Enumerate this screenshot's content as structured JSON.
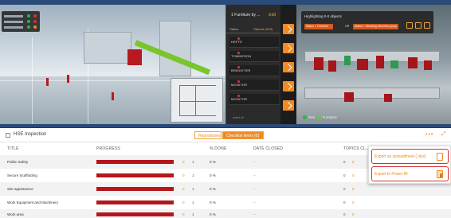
{
  "viewport": {
    "left_panel": {
      "title": "1 Furniture by ...",
      "edit_label": "Edit",
      "tabs": [
        "Status",
        "Objects (263)"
      ],
      "items": [
        "HEFTE",
        "TOMMERON",
        "BRIKKETER",
        "MONITOR",
        "MONITOR"
      ],
      "footer": "select all"
    },
    "right_panel": {
      "title": "Highlighting 0-0 objects",
      "chip_1": "Status = Furniture ...",
      "or_label": "OR",
      "chip_2": "Status = Wedding elements group",
      "legend": [
        "Done",
        "In progress"
      ]
    }
  },
  "hse": {
    "title": "HSE Inspection",
    "tabs": {
      "repositories": "Repositories",
      "checklist": "Checklist items (0)"
    },
    "more_label": "•••",
    "expand_label": "⤢",
    "columns": {
      "title": "TITLE",
      "progress": "PROGRESS",
      "done": "% DONE",
      "closed": "DATE CLOSED",
      "topics": "TOPICS CL..."
    },
    "rows": [
      {
        "title": "Public Safety",
        "a": "0",
        "b": "1",
        "pct": "0 %",
        "date": "–",
        "t0": "0",
        "t1": "0"
      },
      {
        "title": "Secure Scaffolding",
        "a": "0",
        "b": "1",
        "pct": "0 %",
        "date": "–",
        "t0": "0",
        "t1": "0"
      },
      {
        "title": "Site appearance",
        "a": "0",
        "b": "1",
        "pct": "0 %",
        "date": "–",
        "t0": "0",
        "t1": "0"
      },
      {
        "title": "Work Equipment and Machinery",
        "a": "0",
        "b": "1",
        "pct": "0 %",
        "date": "–",
        "t0": "0",
        "t1": "0"
      },
      {
        "title": "Work area",
        "a": "0",
        "b": "1",
        "pct": "0 %",
        "date": "–",
        "t0": "0",
        "t1": "0"
      }
    ]
  },
  "export_menu": {
    "spreadsheet": "Export as spreadsheet (.xlsx)",
    "powerbi": "Export to Power BI"
  },
  "colors": {
    "accent": "#f08a24",
    "progress_bar": "#b5161b",
    "highlight_border": "#d62f2f"
  }
}
